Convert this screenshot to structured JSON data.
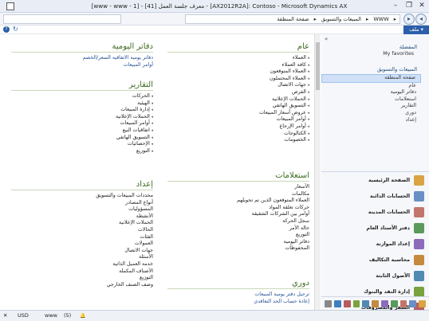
{
  "window": {
    "title": "[www - www - 1] - [41] معرف جلسة العمل - [AX2012R2A]: Contoso - Microsoft Dynamics AX",
    "min": "–",
    "max": "❐",
    "close": "✕"
  },
  "address": {
    "breadcrumb": [
      "WWW",
      "المبيعات والتسويق",
      "صفحة المنطقة"
    ],
    "sep": "▸"
  },
  "menubar": {
    "file": "ملف ▾",
    "help": "?",
    "refresh": "↻"
  },
  "sections": {
    "general": {
      "title": "عام",
      "items": [
        "العملاء",
        "كافة العملاء",
        "العملاء المتوقعون",
        "العملاء المحتملون",
        "جهات الاتصال",
        "الفرص",
        "الحملات الإعلانية",
        "التسويق الهاتفي",
        "عروض أسعار المبيعات",
        "أوامر المبيعات",
        "أوامر الإرجاع",
        "الكتالوجات",
        "الخصومات"
      ]
    },
    "journals": {
      "title": "دفاتر اليومية",
      "items": [
        "دفاتر يومية الاتفاقية السعر/الخصم",
        "أوامر المبيعات"
      ]
    },
    "reports": {
      "title": "التقارير",
      "items": [
        "الحركات",
        "الهيئية",
        "إدارة المبيعات",
        "الحملات الإعلانية",
        "أوامر المبيعات",
        "اتفاقيات البيع",
        "التسويق الهاتفي",
        "الإحصائيات",
        "التوزيع"
      ]
    },
    "inquiries": {
      "title": "استعلامات",
      "items": [
        "الأسعار",
        "مكالمات",
        "العملاء المتوقعون الذين تم تحويلهم",
        "حركات تعلقة المواد",
        "أوامر بين الشركات الشقيقة",
        "سجل الحركة",
        "حالة الأمر",
        "التوزيع",
        "دفاتر اليومية",
        "المحفوظات"
      ]
    },
    "setup": {
      "title": "إعداد",
      "items": [
        "محددات المبيعات والتسويق",
        "أنواع المصادر",
        "المسؤوليات",
        "الأنشطة",
        "الحملات الإعلانية",
        "الحالات",
        "الفئات",
        "العمولات",
        "جهات الاتصال",
        "الأسئلة",
        "خدمة العميل الذاتية",
        "الأصناف المكملة",
        "التوزيع",
        "وصف الصنف الخارجي"
      ]
    },
    "periodic": {
      "title": "دوري",
      "items": [
        "ترحيل دفتر يومية المبيعات",
        "إعادة حساب الحد التعاقدي"
      ]
    }
  },
  "navpane": {
    "favorites_title": "المفضلة",
    "my_favorites": "My favorites",
    "module_title": "المبيعات والتسويق",
    "items": [
      "صفحة المنطقة",
      "عام",
      "دفاتر اليومية",
      "استعلامات",
      "التقارير",
      "دوري",
      "إعداد"
    ],
    "selected": "صفحة المنطقة"
  },
  "modules": [
    {
      "label": "الصفحة الرئيسية",
      "color": "#d9a441"
    },
    {
      "label": "الحسابات الدائنة",
      "color": "#6b8fc4"
    },
    {
      "label": "الحسابات المدينة",
      "color": "#c4756b"
    },
    {
      "label": "دفتر الأستاذ العام",
      "color": "#5a9a5a"
    },
    {
      "label": "إعداد الموازنة",
      "color": "#8c6bb8"
    },
    {
      "label": "محاسبة التكاليف",
      "color": "#c48a3f"
    },
    {
      "label": "الأصول الثابتة",
      "color": "#4f8ab0"
    },
    {
      "label": "إدارة النقد والبنوك",
      "color": "#7aa33d"
    },
    {
      "label": "السفر والمصروفات",
      "color": "#b85c5c"
    }
  ],
  "iconstrip_colors": [
    "#d9a441",
    "#6b8fc4",
    "#c4756b",
    "#5a9a5a",
    "#8c6bb8",
    "#c48a3f",
    "#4f8ab0",
    "#7aa33d",
    "#b85c5c",
    "#3f7fbf",
    "#888"
  ],
  "statusbar": {
    "usd": "USD",
    "www": "www",
    "count": "(5)",
    "bell": "🔔",
    "close": "✕"
  }
}
